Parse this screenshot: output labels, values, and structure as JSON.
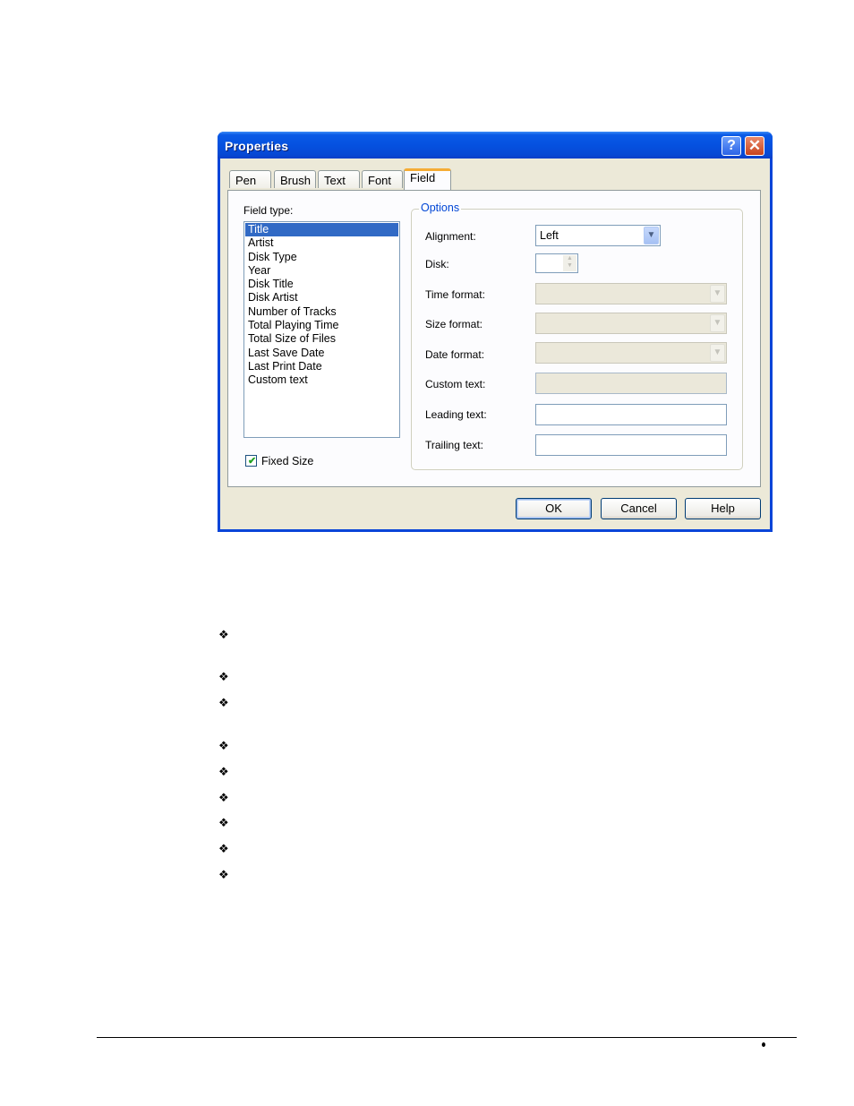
{
  "dialog": {
    "title": "Properties",
    "title_buttons": {
      "help_icon": "?",
      "close_icon": "✕"
    },
    "tabs": [
      {
        "label": "Pen",
        "active": false
      },
      {
        "label": "Brush",
        "active": false
      },
      {
        "label": "Text",
        "active": false
      },
      {
        "label": "Font",
        "active": false
      },
      {
        "label": "Field",
        "active": true
      }
    ],
    "field_type": {
      "label": "Field type:",
      "items": [
        "Title",
        "Artist",
        "Disk Type",
        "Year",
        "Disk Title",
        "Disk Artist",
        "Number of Tracks",
        "Total Playing Time",
        "Total Size of Files",
        "Last Save Date",
        "Last Print Date",
        "Custom text"
      ],
      "selected": "Title"
    },
    "fixed_size": {
      "label": "Fixed Size",
      "checked": true,
      "check_glyph": "✔"
    },
    "options": {
      "legend": "Options",
      "alignment": {
        "label": "Alignment:",
        "value": "Left",
        "arrow": "▼"
      },
      "disk": {
        "label": "Disk:",
        "value": "",
        "up": "▲",
        "down": "▼"
      },
      "time_format": {
        "label": "Time format:",
        "value": "",
        "arrow": "▼"
      },
      "size_format": {
        "label": "Size format:",
        "value": "",
        "arrow": "▼"
      },
      "date_format": {
        "label": "Date format:",
        "value": "",
        "arrow": "▼"
      },
      "custom_text": {
        "label": "Custom text:",
        "value": ""
      },
      "leading_text": {
        "label": "Leading text:",
        "value": ""
      },
      "trailing_text": {
        "label": "Trailing text:",
        "value": ""
      }
    },
    "buttons": {
      "ok": "OK",
      "cancel": "Cancel",
      "help": "Help"
    }
  },
  "page": {
    "bullet_glyph": "❖",
    "bullet_count": 9
  },
  "colors": {
    "title_bar": "#0551e0",
    "selection": "#316ac5",
    "group_legend": "#0046d5",
    "dialog_bg": "#ece9d8",
    "active_tab_accent": "#f5ac35"
  }
}
